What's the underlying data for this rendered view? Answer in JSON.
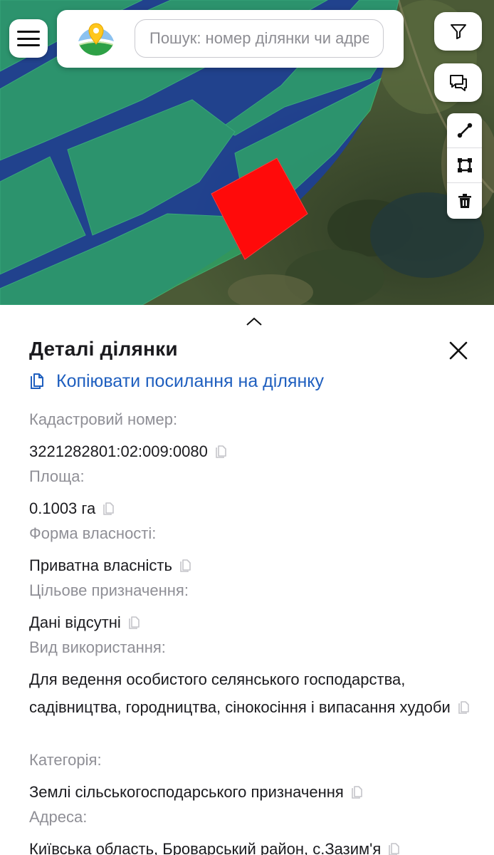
{
  "header": {
    "menu_icon": "hamburger-menu-icon",
    "logo_icon": "map-pin-logo-icon",
    "search_placeholder": "Пошук: номер ділянки чи адреса",
    "search_value": ""
  },
  "map_tools": {
    "filter_icon": "filter-icon",
    "chat_icon": "chat-bubbles-icon",
    "draw_tools": [
      "measure-line-icon",
      "draw-polygon-icon",
      "trash-icon"
    ]
  },
  "colors": {
    "parcel_highlight": "#ff0a0a",
    "parcel_fill_green": "#2fa566",
    "road_fill_blue": "#1b3f9a",
    "link_blue": "#1f5fbf",
    "label_gray": "#8f8f96"
  },
  "panel": {
    "title": "Деталі ділянки",
    "copy_link_label": "Копіювати посилання на ділянку",
    "fields": [
      {
        "label": "Кадастровий номер:",
        "value": "3221282801:02:009:0080"
      },
      {
        "label": "Площа:",
        "value": "0.1003 га"
      },
      {
        "label": "Форма власності:",
        "value": "Приватна власність"
      },
      {
        "label": "Цільове призначення:",
        "value": "Дані відсутні"
      },
      {
        "label": "Вид використання:",
        "value": "Для ведення особистого селянського господарства, садівництва, городництва, сінокосіння і випасання худоби"
      },
      {
        "label": "Категорія:",
        "value": "Землі сільськогосподарського призначення"
      },
      {
        "label": "Адреса:",
        "value": "Київська область, Броварський район, с.Зазим'я"
      }
    ]
  }
}
